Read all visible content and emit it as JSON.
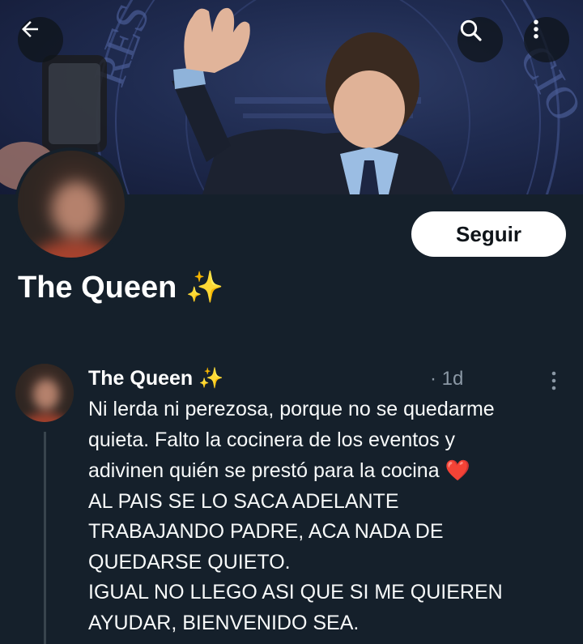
{
  "header": {
    "back_icon": "arrow-left-icon",
    "search_icon": "search-icon",
    "more_icon": "more-vertical-icon"
  },
  "profile": {
    "name": "The Queen",
    "name_emoji": "✨",
    "follow_label": "Seguir"
  },
  "tweet": {
    "author": "The Queen",
    "author_emoji": "✨",
    "time": "· 1d",
    "lines": [
      "Ni lerda ni perezosa, porque no se quedarme",
      "quieta. Falto la cocinera de los eventos y",
      "adivinen quién se prestó para la cocina",
      "AL PAIS SE LO SACA ADELANTE",
      "TRABAJANDO PADRE, ACA NADA DE",
      "QUEDARSE QUIETO.",
      "IGUAL NO LLEGO ASI QUE SI ME QUIEREN",
      "AYUDAR, BIENVENIDO SEA."
    ],
    "heart_emoji": "❤️"
  },
  "colors": {
    "background": "#15202b",
    "secondary_text": "#8b98a5",
    "heart": "#e0245e"
  }
}
